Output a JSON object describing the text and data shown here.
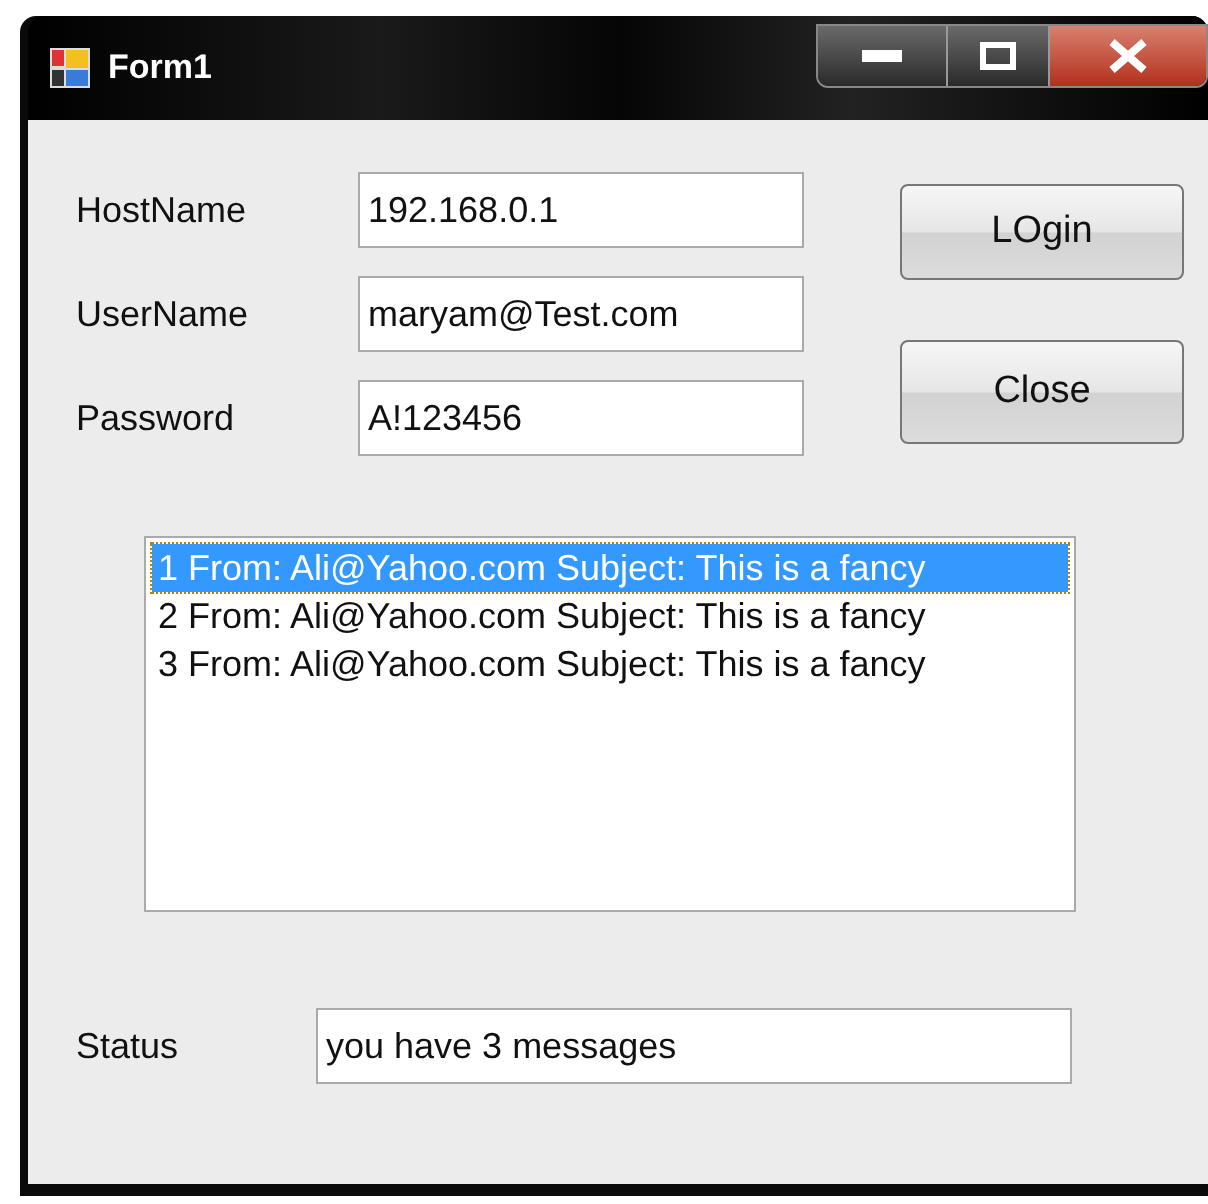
{
  "window": {
    "title": "Form1"
  },
  "fields": [
    {
      "label": "HostName",
      "value": "192.168.0.1"
    },
    {
      "label": "UserName",
      "value": "maryam@Test.com"
    },
    {
      "label": "Password",
      "value": "A!123456"
    }
  ],
  "buttons": [
    {
      "label": "LOgin"
    },
    {
      "label": "Close"
    }
  ],
  "messages": [
    {
      "text": "1 From: Ali@Yahoo.com Subject: This is a fancy",
      "selected": true
    },
    {
      "text": "2 From: Ali@Yahoo.com Subject: This is a fancy",
      "selected": false
    },
    {
      "text": "3 From: Ali@Yahoo.com Subject: This is a fancy",
      "selected": false
    }
  ],
  "status": {
    "label": "Status",
    "value": "you have 3 messages"
  }
}
